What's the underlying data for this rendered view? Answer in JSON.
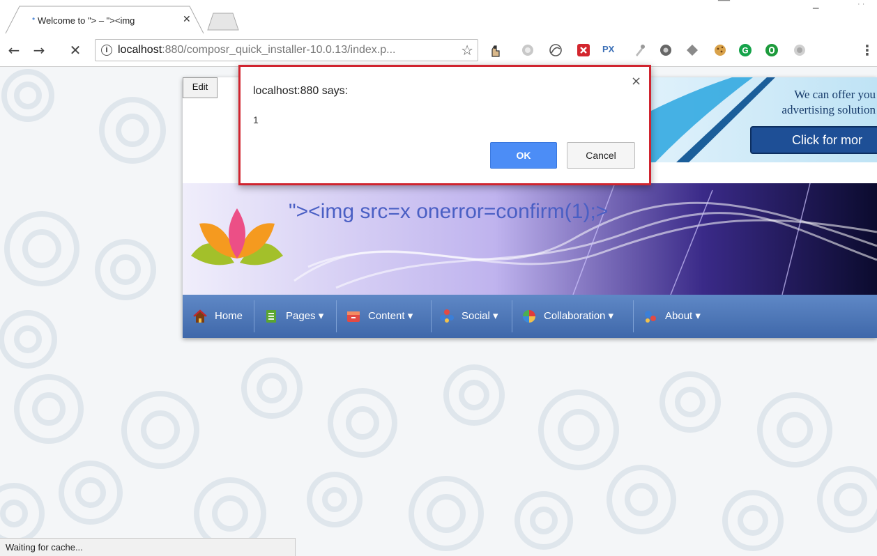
{
  "browser": {
    "tab_title": "Welcome to \"> – \"><img",
    "tab_close": "✕",
    "url_host": "localhost",
    "url_path": ":880/composr_quick_installer-10.0.13/index.p...",
    "status_text": "Waiting for cache...",
    "extensions": [
      "hand-icon",
      "ghost-icon",
      "swirl-icon",
      "x-extension-icon",
      "px-icon",
      "dropper-icon",
      "tracker-icon",
      "diamond-icon",
      "cookie-icon",
      "grammarly-icon",
      "d-extension-icon",
      "globe-icon"
    ],
    "extension_px_label": "PX"
  },
  "site": {
    "edit_label": "Edit",
    "title": "\"><img src=x onerror=confirm(1);>",
    "ad": {
      "line1": "We can offer you",
      "line2": "advertising solution",
      "button": "Click for mor"
    },
    "nav": [
      {
        "label": "Home",
        "icon": "home-icon"
      },
      {
        "label": "Pages ▾",
        "icon": "pages-icon"
      },
      {
        "label": "Content ▾",
        "icon": "content-icon"
      },
      {
        "label": "Social ▾",
        "icon": "social-icon"
      },
      {
        "label": "Collaboration ▾",
        "icon": "collaboration-icon"
      },
      {
        "label": "About ▾",
        "icon": "about-icon"
      }
    ]
  },
  "dialog": {
    "title": "localhost:880 says:",
    "message": "1",
    "ok_label": "OK",
    "cancel_label": "Cancel",
    "close_label": "×"
  },
  "colors": {
    "dialog_highlight": "#d0242f",
    "ok_button": "#4c8df6",
    "nav_bar": "#4f78b8",
    "title_text": "#4a5fc4"
  }
}
